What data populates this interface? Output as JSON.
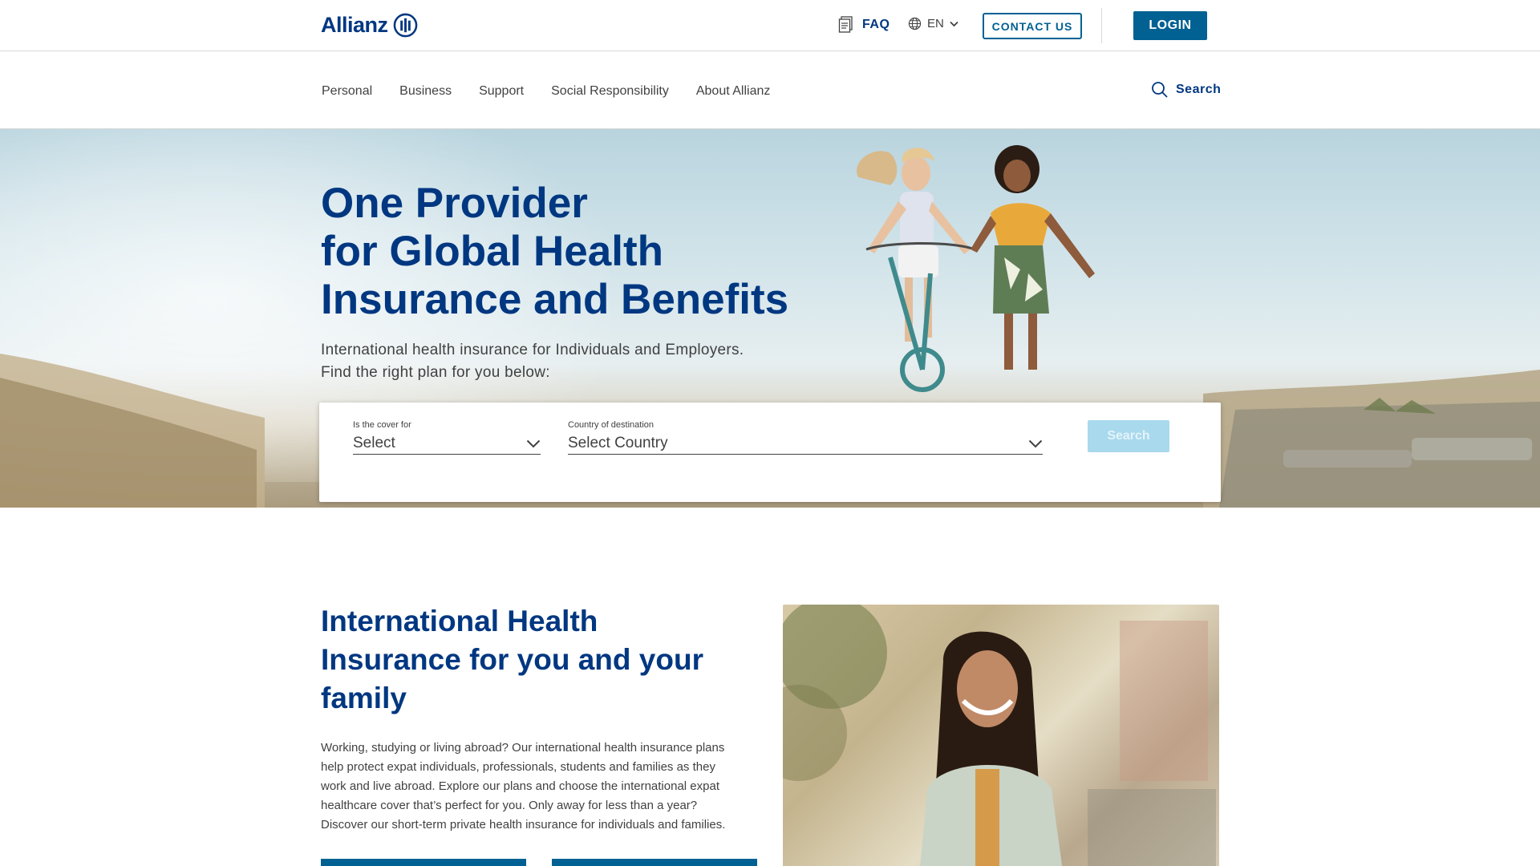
{
  "brand": {
    "name": "Allianz",
    "primary_color": "#003781",
    "accent_color": "#006192"
  },
  "topbar": {
    "faq_label": "FAQ",
    "faq_icon": "document-icon",
    "lang_label": "EN",
    "lang_icon": "globe-icon",
    "contact_label": "CONTACT US",
    "login_label": "LOGIN"
  },
  "nav": {
    "items": [
      {
        "label": "Personal"
      },
      {
        "label": "Business"
      },
      {
        "label": "Support"
      },
      {
        "label": "Social Responsibility"
      },
      {
        "label": "About Allianz"
      }
    ],
    "search_label": "Search",
    "search_icon": "search-icon"
  },
  "hero": {
    "title_lines": [
      "One Provider",
      "for Global Health",
      "Insurance and Benefits"
    ],
    "subtitle_lines": [
      "International health insurance for Individuals and Employers.",
      "Find the right plan for you below:"
    ]
  },
  "search_card": {
    "cover_label": "Is the cover for",
    "cover_value": "Select",
    "country_label": "Country of destination",
    "country_value": "Select Country",
    "button_label": "Search"
  },
  "section2": {
    "title_lines": [
      "International Health",
      "Insurance for you and your",
      "family"
    ],
    "body_lines": [
      "Working, studying or living abroad? Our international health insurance plans",
      "help protect expat individuals, professionals, students and families as they",
      "work and live abroad. Explore our plans and choose the international expat",
      "healthcare cover that’s perfect for you. Only away for less than a year?",
      "Discover our short-term private health insurance for individuals and families."
    ]
  }
}
